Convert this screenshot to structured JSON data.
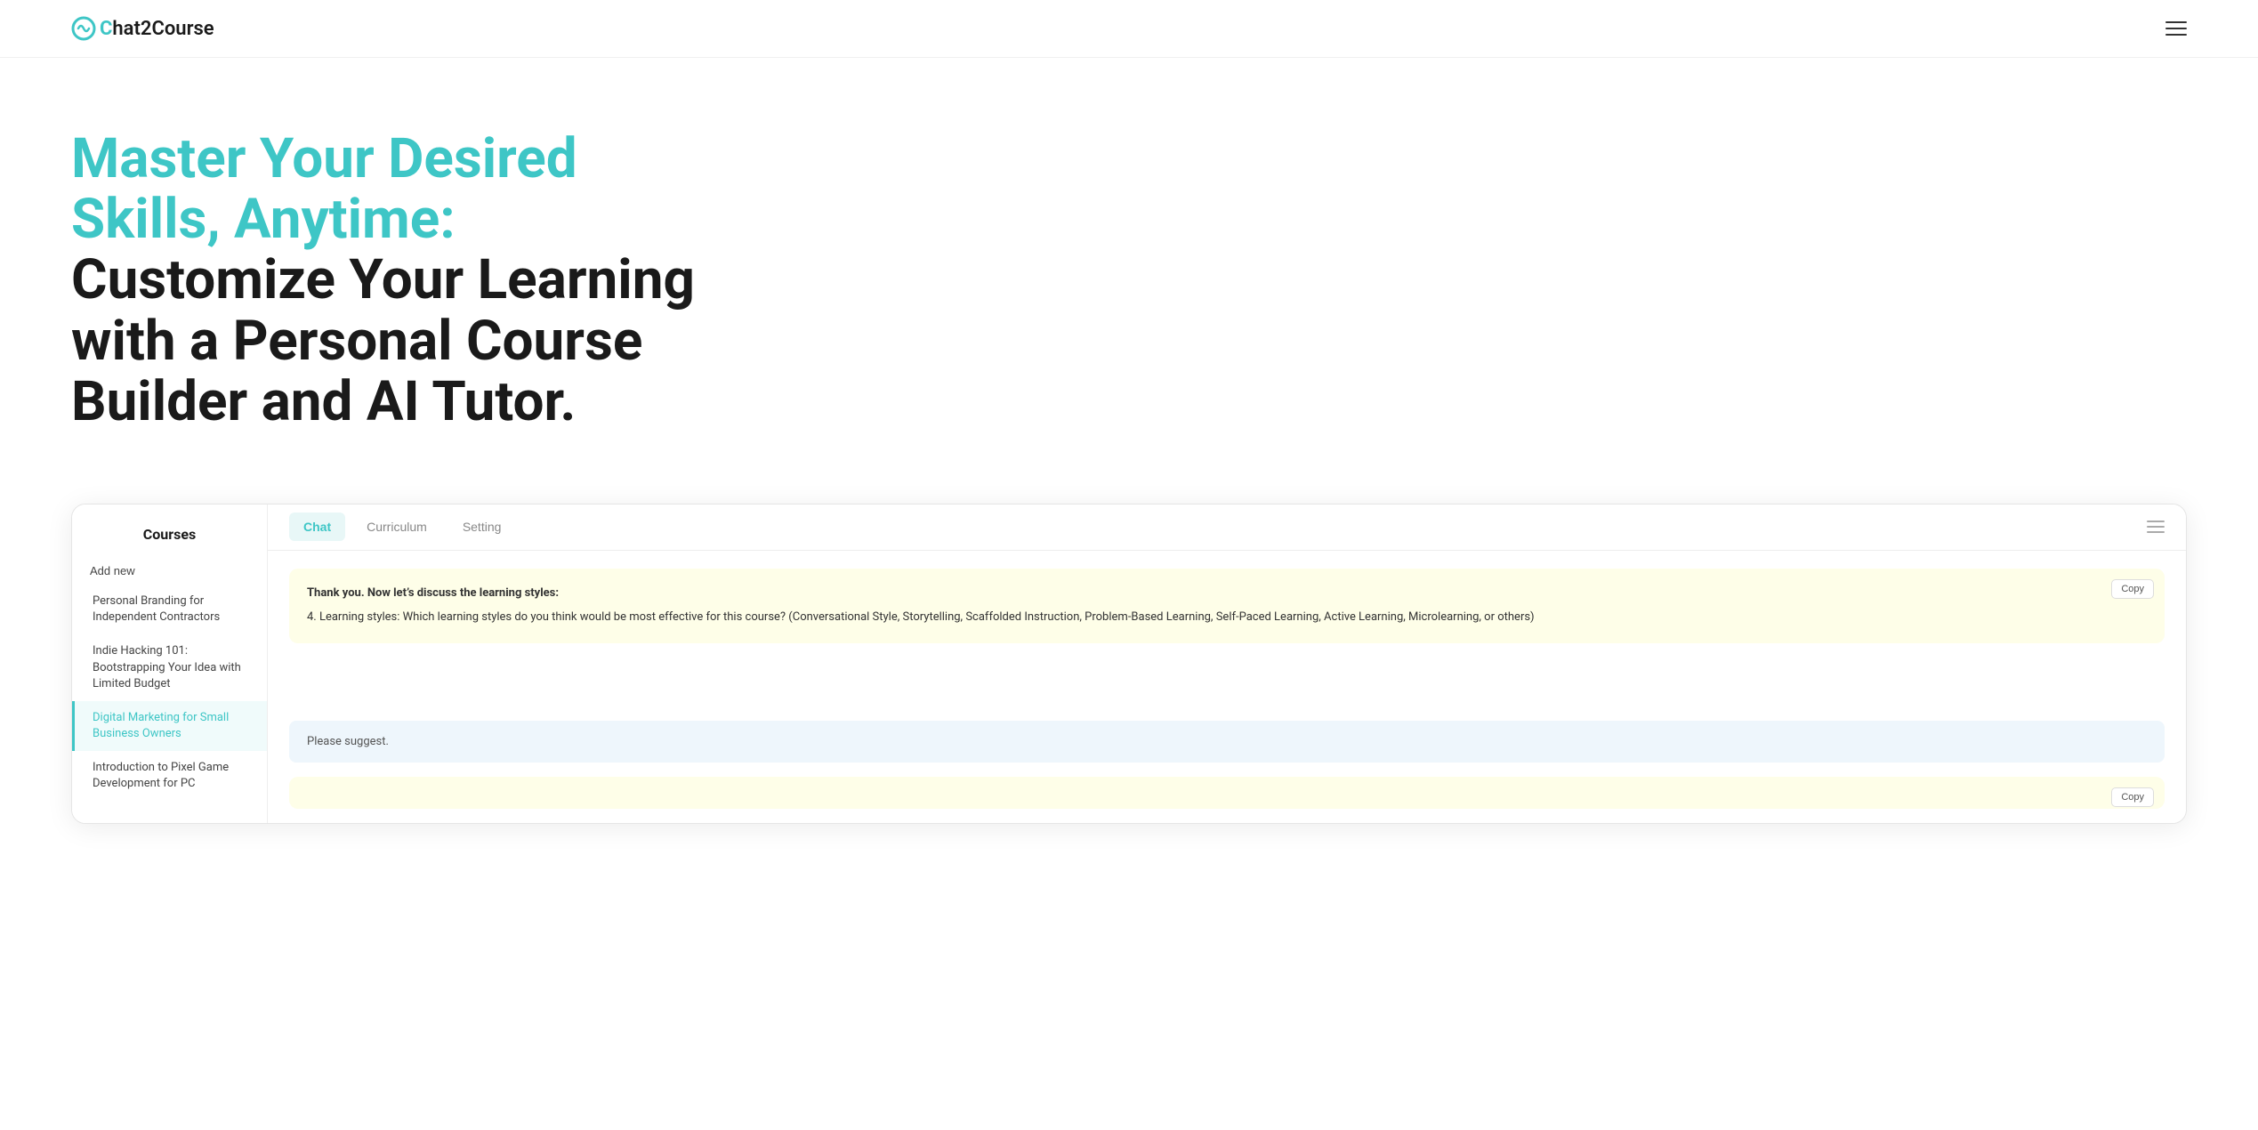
{
  "navbar": {
    "logo_text": "hat2Course",
    "logo_prefix": "C",
    "menu_icon_label": "main-menu"
  },
  "hero": {
    "title_accent": "Master Your Desired Skills, Anytime:",
    "title_normal": " Customize Your Learning with a Personal Course Builder and AI Tutor."
  },
  "app": {
    "sidebar": {
      "title": "Courses",
      "add_new": "Add new",
      "courses": [
        {
          "name": "Personal Branding for Independent Contractors",
          "active": false
        },
        {
          "name": "Indie Hacking 101: Bootstrapping Your Idea with Limited Budget",
          "active": false
        },
        {
          "name": "Digital Marketing for Small Business Owners",
          "active": true
        },
        {
          "name": "Introduction to Pixel Game Development for PC",
          "active": false
        }
      ]
    },
    "tabs": [
      {
        "label": "Chat",
        "active": true
      },
      {
        "label": "Curriculum",
        "active": false
      },
      {
        "label": "Setting",
        "active": false
      }
    ],
    "chat": {
      "ai_message_1_title": "Thank you. Now let’s discuss the learning styles:",
      "ai_message_1_body": "4. Learning styles: Which learning styles do you think would be most effective for this course? (Conversational Style, Storytelling, Scaffolded Instruction, Problem-Based Learning, Self-Paced Learning, Active Learning, Microlearning, or others)",
      "user_message": "Please suggest.",
      "ai_message_2_copy": "Copy"
    },
    "copy_label": "Copy",
    "menu_icon_label": "app-menu"
  }
}
